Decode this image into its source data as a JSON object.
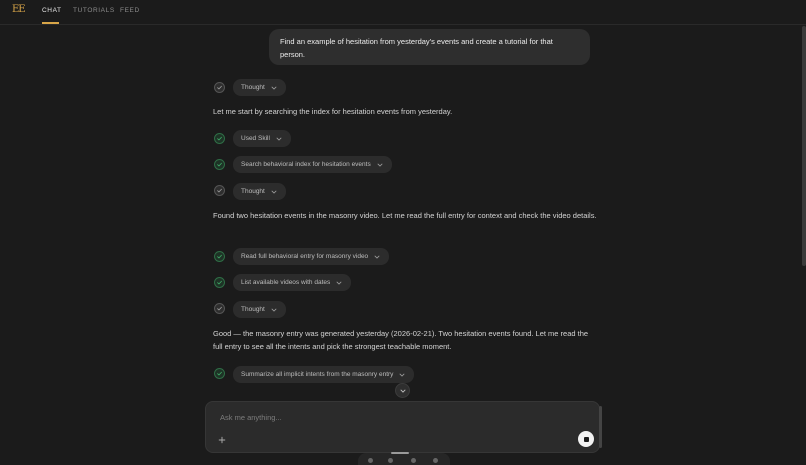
{
  "app": {
    "logo_text": "EE"
  },
  "nav": {
    "tabs": [
      {
        "label": "CHAT",
        "active": true
      },
      {
        "label": "TUTORIALS",
        "active": false
      },
      {
        "label": "FEED",
        "active": false
      }
    ]
  },
  "conversation": {
    "user_message": "Find an example of hesitation from yesterday's events and create a tutorial for that person.",
    "steps": [
      {
        "type": "thought",
        "label": "Thought"
      },
      {
        "type": "text",
        "text": "Let me start by searching the index for hesitation events from yesterday."
      },
      {
        "type": "tool",
        "label": "Used Skill"
      },
      {
        "type": "tool",
        "label": "Search behavioral index for hesitation events"
      },
      {
        "type": "thought",
        "label": "Thought"
      },
      {
        "type": "text",
        "text": "Found two hesitation events in the masonry video. Let me read the full entry for context and check the video details."
      },
      {
        "type": "tool",
        "label": "Read full behavioral entry for masonry video"
      },
      {
        "type": "tool",
        "label": "List available videos with dates"
      },
      {
        "type": "thought",
        "label": "Thought"
      },
      {
        "type": "text",
        "text": "Good — the masonry entry was generated yesterday (2026-02-21). Two hesitation events found. Let me read the full entry to see all the intents and pick the strongest teachable moment."
      },
      {
        "type": "tool",
        "label": "Summarize all implicit intents from the masonry entry"
      }
    ]
  },
  "composer": {
    "placeholder": "Ask me anything...",
    "value": ""
  },
  "colors": {
    "accent": "#d8a548",
    "background": "#1b1b1b",
    "done_check": "#3fa866"
  }
}
